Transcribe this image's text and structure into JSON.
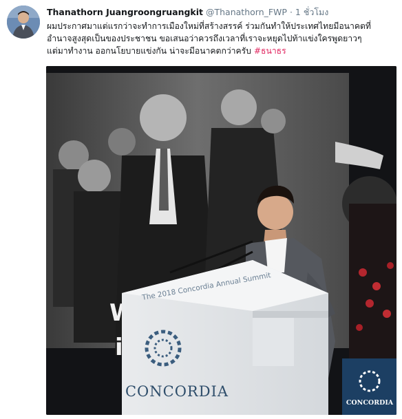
{
  "tweet": {
    "author_name": "Thanathorn Juangroongruangkit",
    "author_handle": "@Thanathorn_FWP",
    "separator": "·",
    "time": "1 ชั่วโมง",
    "text_lines": [
      "ผมประกาศมาแต่แรกว่าจะทำการเมืองใหม่ที่สร้างสรรค์ ร่วมกันทำให้ประเทศไทยมีอนาคตที่",
      "อำนาจสูงสุดเป็นของประชาชน ขอเสนอว่าควรถึงเวลาที่เราจะหยุดไปท้าแข่งใครพูดยาวๆ",
      "แต่มาทำงาน ออกนโยบายแข่งกัน น่าจะมีอนาคตกว่าครับ"
    ],
    "hashtag": "#ธนาธร"
  },
  "photo": {
    "podium_summit_text": "The 2018 Concordia Annual Summit",
    "podium_brand": "CONCORDIA",
    "banner_brand": "CONCORDIA",
    "screen_fragment_1": "W",
    "screen_fragment_2": "i"
  },
  "colors": {
    "hashtag": "#e0245e",
    "secondary_text": "#657786",
    "concordia_blue": "#2f4e6b"
  }
}
